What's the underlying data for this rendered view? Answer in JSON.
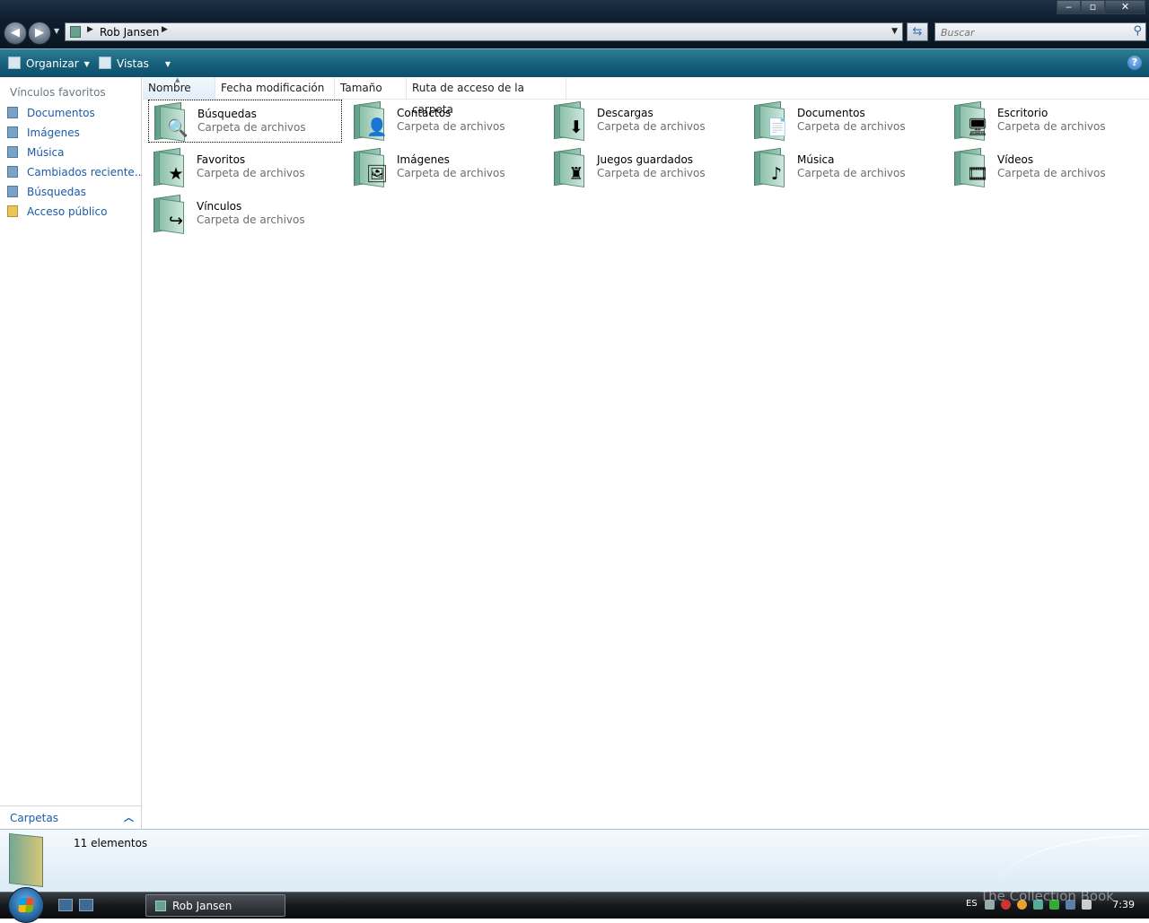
{
  "address": {
    "crumb": "Rob Jansen"
  },
  "search": {
    "placeholder": "Buscar"
  },
  "window_controls": {
    "minimize": "‒",
    "maximize": "▫",
    "close": "✕"
  },
  "commandbar": {
    "organize": "Organizar",
    "views": "Vistas",
    "help": "?"
  },
  "navpane": {
    "title": "Vínculos favoritos",
    "items": [
      {
        "label": "Documentos",
        "icon": "documents-icon"
      },
      {
        "label": "Imágenes",
        "icon": "pictures-icon"
      },
      {
        "label": "Música",
        "icon": "music-icon"
      },
      {
        "label": "Cambiados reciente...",
        "icon": "recent-icon"
      },
      {
        "label": "Búsquedas",
        "icon": "searches-icon"
      },
      {
        "label": "Acceso público",
        "icon": "public-folder-icon"
      }
    ],
    "folders_label": "Carpetas"
  },
  "columns": [
    "Nombre",
    "Fecha modificación",
    "Tamaño",
    "Ruta de acceso de la carpeta"
  ],
  "items": [
    {
      "name": "Búsquedas",
      "type": "Carpeta de archivos",
      "badge": "🔍",
      "selected": true
    },
    {
      "name": "Contactos",
      "type": "Carpeta de archivos",
      "badge": "👤"
    },
    {
      "name": "Descargas",
      "type": "Carpeta de archivos",
      "badge": "⬇"
    },
    {
      "name": "Documentos",
      "type": "Carpeta de archivos",
      "badge": "📄"
    },
    {
      "name": "Escritorio",
      "type": "Carpeta de archivos",
      "badge": "🖥"
    },
    {
      "name": "Favoritos",
      "type": "Carpeta de archivos",
      "badge": "★"
    },
    {
      "name": "Imágenes",
      "type": "Carpeta de archivos",
      "badge": "🖼"
    },
    {
      "name": "Juegos guardados",
      "type": "Carpeta de archivos",
      "badge": "♜"
    },
    {
      "name": "Música",
      "type": "Carpeta de archivos",
      "badge": "♪"
    },
    {
      "name": "Vídeos",
      "type": "Carpeta de archivos",
      "badge": "🎞"
    },
    {
      "name": "Vínculos",
      "type": "Carpeta de archivos",
      "badge": "↪"
    }
  ],
  "details": {
    "count": "11 elementos"
  },
  "taskbar": {
    "task_label": "Rob Jansen",
    "language": "ES",
    "clock": "7:39"
  },
  "watermark": "The Collection Book",
  "colors": {
    "link": "#1c5aa8",
    "command_bar": "#17617c",
    "folder": "#8cc0aa"
  }
}
